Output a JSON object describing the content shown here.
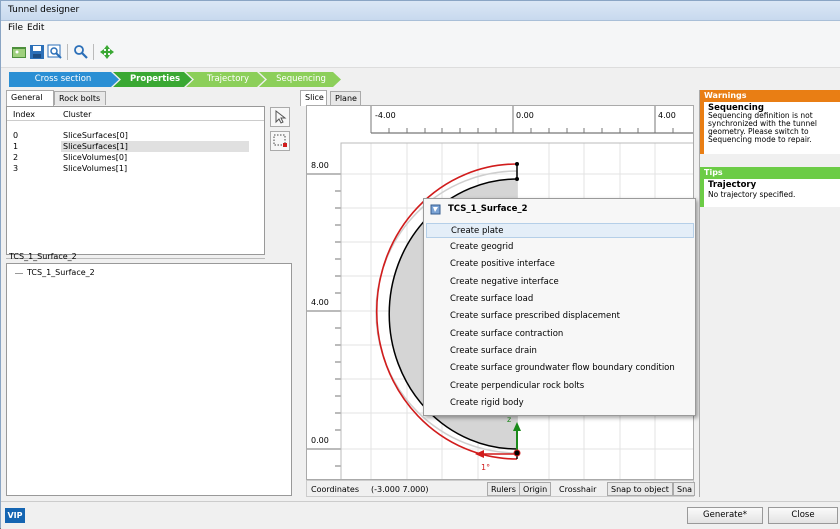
{
  "window": {
    "title": "Tunnel designer"
  },
  "menu": {
    "items": [
      "File",
      "Edit"
    ]
  },
  "toolbar": {
    "icons": [
      "open-icon",
      "save-icon",
      "zoom-icon",
      "search-icon",
      "move-icon"
    ]
  },
  "wizard": {
    "steps": [
      "Cross section",
      "Properties",
      "Trajectory",
      "Sequencing"
    ],
    "active": "Properties"
  },
  "left": {
    "tabs": [
      "General",
      "Rock bolts"
    ],
    "table": {
      "headers": [
        "Index",
        "Cluster"
      ],
      "rows": [
        {
          "index": "0",
          "cluster": "SliceSurfaces[0]"
        },
        {
          "index": "1",
          "cluster": "SliceSurfaces[1]"
        },
        {
          "index": "2",
          "cluster": "SliceVolumes[0]"
        },
        {
          "index": "3",
          "cluster": "SliceVolumes[1]"
        }
      ]
    },
    "selection_title": "TCS_1_Surface_2",
    "tree_item": "TCS_1_Surface_2"
  },
  "center": {
    "tabs": [
      "Slice",
      "Plane"
    ],
    "ruler_labels": [
      "-4.00",
      "0.00",
      "4.00"
    ],
    "y_labels": [
      "8.00",
      "4.00",
      "0.00"
    ],
    "markers": {
      "bottom": "1°",
      "arrow": "z"
    },
    "status": {
      "coordinates_label": "Coordinates",
      "coordinates_value": "(-3.000 7.000)",
      "buttons": [
        "Rulers",
        "Origin"
      ],
      "crosshair": "Crosshair",
      "snap": "Snap to object",
      "snap2": "Sna"
    }
  },
  "context_menu": {
    "title": "TCS_1_Surface_2",
    "items": [
      "Create plate",
      "Create geogrid",
      "Create positive interface",
      "Create negative interface",
      "Create surface load",
      "Create surface prescribed displacement",
      "Create surface contraction",
      "Create surface drain",
      "Create surface groundwater flow boundary condition",
      "Create perpendicular rock bolts",
      "Create rigid body"
    ]
  },
  "right": {
    "warnings": {
      "header": "Warnings",
      "title": "Sequencing",
      "lines": [
        "Sequencing definition is not",
        "synchronized with the tunnel",
        "geometry. Please switch to",
        "Sequencing mode to repair."
      ]
    },
    "tips": {
      "header": "Tips",
      "title": "Trajectory",
      "text": "No trajectory specified."
    }
  },
  "bottom": {
    "logo": "VIP",
    "generate": "Generate*",
    "close": "Close"
  },
  "colors": {
    "wizard_active": "#3aa833",
    "wizard_inactive": "#8ccf5a",
    "wizard_first": "#2a8fd4",
    "warning": "#e97e14",
    "tips": "#6ccc46",
    "tunnel_outline": "#d11c1c"
  }
}
